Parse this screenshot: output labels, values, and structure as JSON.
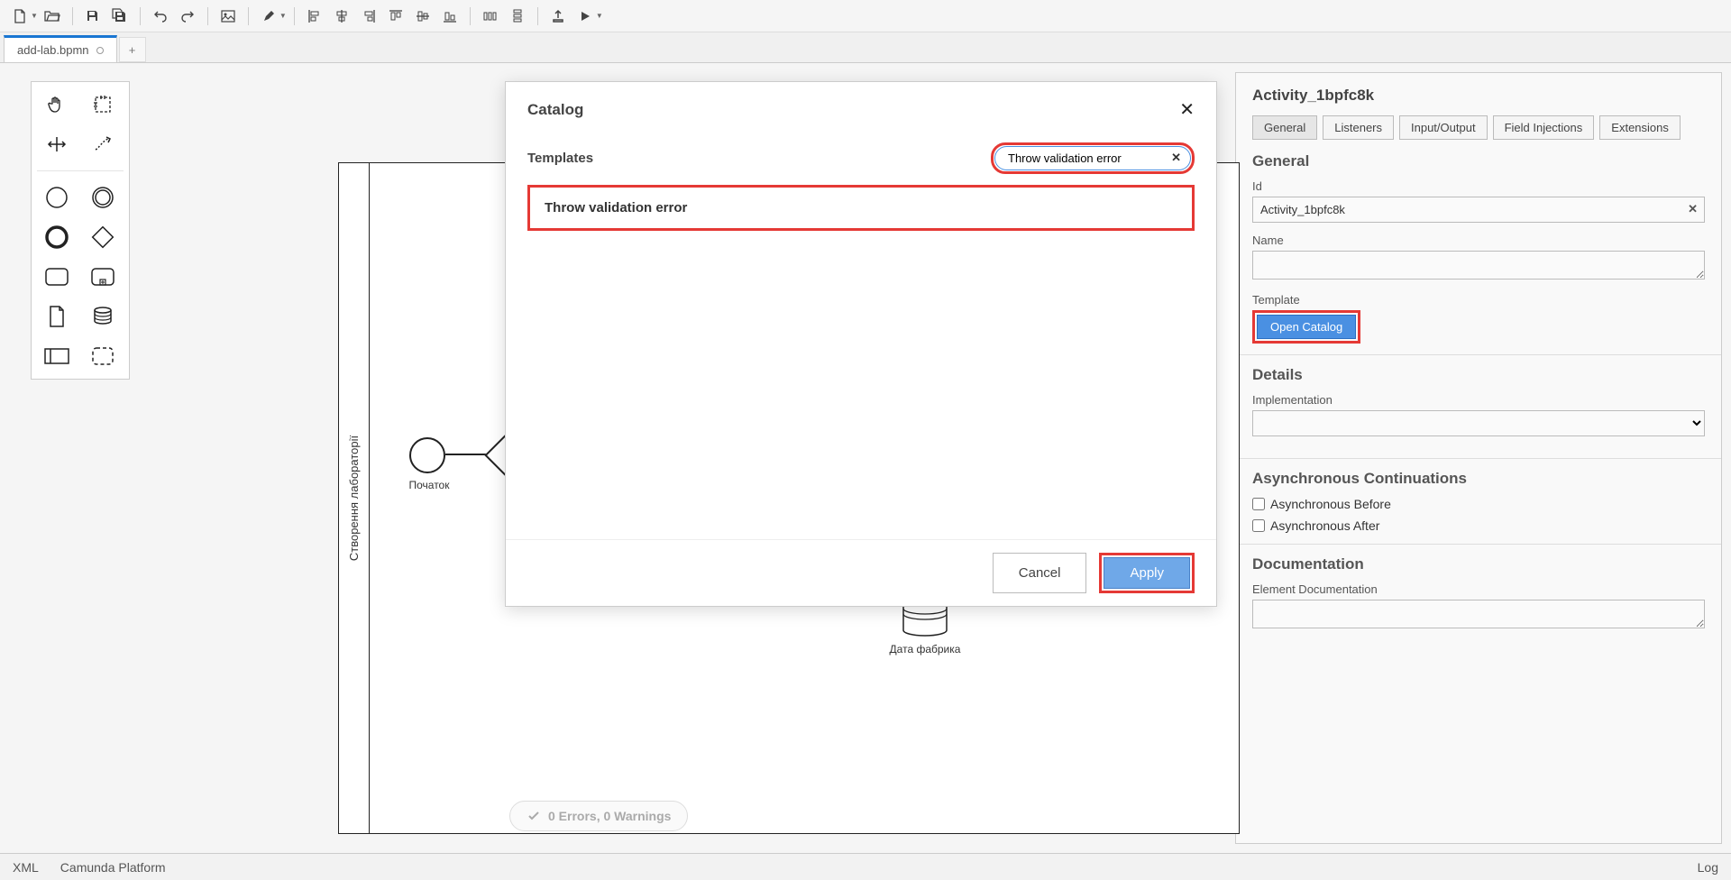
{
  "tab": {
    "filename": "add-lab.bpmn"
  },
  "diagram": {
    "lane_label": "Створення лабораторії",
    "start_label": "Початок",
    "datastore_label": "Дата фабрика"
  },
  "status": {
    "text": "0 Errors, 0 Warnings"
  },
  "footer": {
    "xml": "XML",
    "platform": "Camunda Platform",
    "log": "Log"
  },
  "modal": {
    "title": "Catalog",
    "templates_label": "Templates",
    "search_value": "Throw validation error",
    "result": "Throw validation error",
    "cancel": "Cancel",
    "apply": "Apply"
  },
  "props": {
    "header": "Activity_1bpfc8k",
    "tabs": [
      "General",
      "Listeners",
      "Input/Output",
      "Field Injections",
      "Extensions"
    ],
    "general_title": "General",
    "id_label": "Id",
    "id_value": "Activity_1bpfc8k",
    "name_label": "Name",
    "template_label": "Template",
    "open_catalog": "Open Catalog",
    "details_title": "Details",
    "impl_label": "Implementation",
    "async_title": "Asynchronous Continuations",
    "async_before": "Asynchronous Before",
    "async_after": "Asynchronous After",
    "doc_title": "Documentation",
    "doc_label": "Element Documentation"
  }
}
